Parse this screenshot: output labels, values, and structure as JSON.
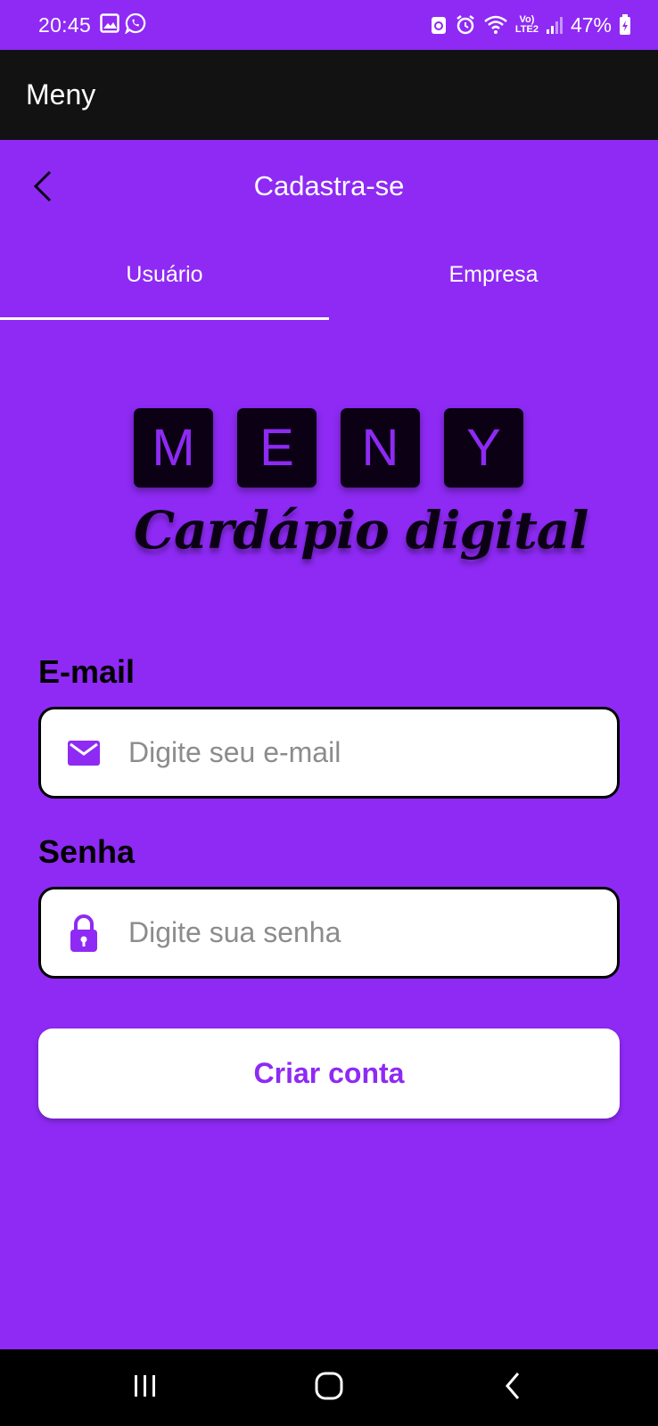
{
  "status_bar": {
    "time": "20:45",
    "battery": "47%",
    "icons": [
      "gallery-icon",
      "whatsapp-icon",
      "recycle-icon",
      "alarm-icon",
      "wifi-icon",
      "volte-icon",
      "signal-icon",
      "battery-icon"
    ],
    "volte_top": "Vo)",
    "volte_bottom": "LTE2"
  },
  "app_bar": {
    "title": "Meny"
  },
  "header": {
    "title": "Cadastra-se",
    "back_icon": "chevron-left-icon"
  },
  "tabs": [
    {
      "label": "Usuário",
      "selected": true
    },
    {
      "label": "Empresa",
      "selected": false
    }
  ],
  "logo": {
    "letters": [
      "M",
      "E",
      "N",
      "Y"
    ],
    "subtitle": "Cardápio digital"
  },
  "form": {
    "email": {
      "label": "E-mail",
      "placeholder": "Digite seu e-mail",
      "value": "",
      "icon": "mail-icon"
    },
    "password": {
      "label": "Senha",
      "placeholder": "Digite sua senha",
      "value": "",
      "icon": "lock-icon"
    },
    "submit_label": "Criar conta"
  },
  "nav_bar": {
    "buttons": [
      "recents-icon",
      "home-icon",
      "back-icon"
    ]
  },
  "colors": {
    "primary": "#8e2af4",
    "app_bar": "#121212",
    "tile": "#0b0014",
    "input_bg": "#ffffff",
    "placeholder": "#8c8c8c"
  }
}
